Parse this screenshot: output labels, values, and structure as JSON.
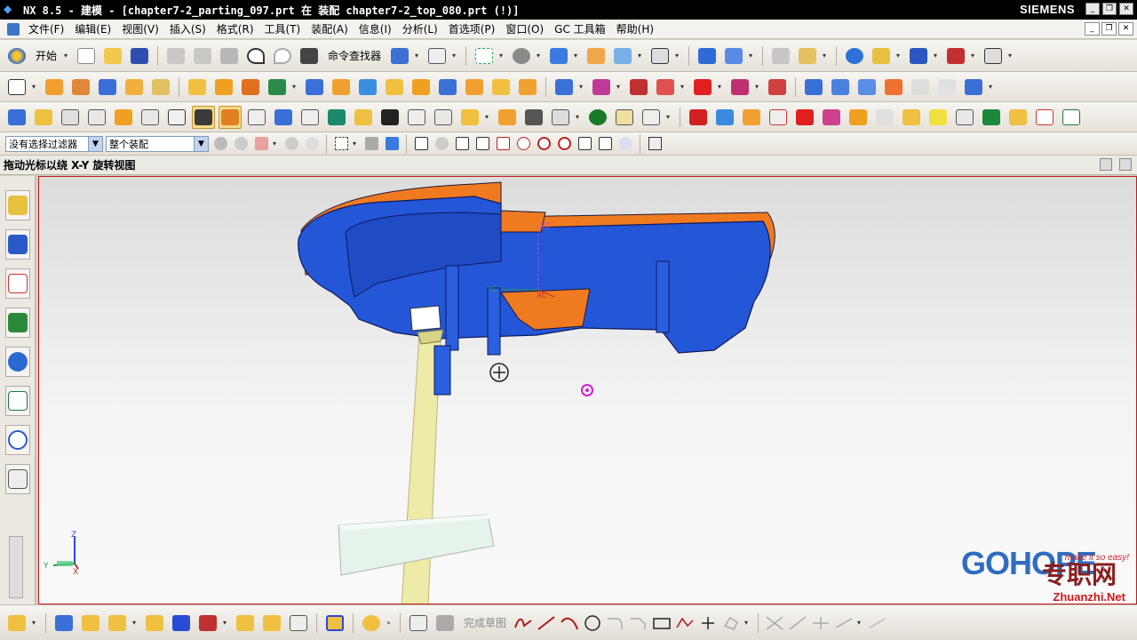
{
  "window": {
    "title": "NX 8.5 - 建模 - [chapter7-2_parting_097.prt 在 装配 chapter7-2_top_080.prt    (!)]",
    "brand": "SIEMENS"
  },
  "menu": {
    "items": [
      "文件(F)",
      "编辑(E)",
      "视图(V)",
      "插入(S)",
      "格式(R)",
      "工具(T)",
      "装配(A)",
      "信息(I)",
      "分析(L)",
      "首选项(P)",
      "窗口(O)",
      "GC 工具箱",
      "帮助(H)"
    ]
  },
  "toolbar1": {
    "start_label": "开始",
    "command_finder_label": "命令查找器"
  },
  "selection_bar": {
    "filter_value": "没有选择过滤器",
    "scope_value": "整个装配"
  },
  "cue_line": {
    "text": "拖动光标以绕 X-Y 旋转视图"
  },
  "viewport": {
    "triad_labels": {
      "z": "Z",
      "y": "Y",
      "x": "X"
    },
    "wcs_labels": {
      "zc": "ZC",
      "yc": "YC",
      "xc": "XC"
    }
  },
  "bottom_toolbar": {
    "finish_sketch_label": "完成草图"
  },
  "watermark": {
    "logo": "GOHOPE",
    "slogan": "make it so easy!",
    "cn": "专职网",
    "site": "Zhuanzhi.Net"
  },
  "colors": {
    "part_blue": "#2456d8",
    "part_orange": "#f07a20",
    "fixture_yellow": "#eeeaa8",
    "block_mint": "#e6f3ea",
    "viewport_border": "#c21a1a"
  },
  "icons": {
    "toolbar1": [
      "new-file-icon",
      "open-folder-icon",
      "save-icon",
      "cut-icon",
      "copy-icon",
      "paste-icon",
      "undo-icon",
      "redo-icon",
      "binoculars-icon",
      "cube-view-icon",
      "info-icon",
      "fit-icon",
      "render-icon",
      "shaded-cube-icon",
      "folder-icon",
      "arrow-cube-icon",
      "background-icon",
      "orient-icon",
      "layer-icon",
      "wcs-icon",
      "measure-icon",
      "snap-icon",
      "ruler-icon"
    ]
  }
}
